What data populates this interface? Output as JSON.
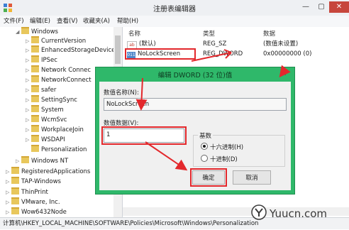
{
  "window": {
    "title": "注册表编辑器"
  },
  "menu": [
    "文件(F)",
    "编辑(E)",
    "查看(V)",
    "收藏夹(A)",
    "帮助(H)"
  ],
  "tree": {
    "items": [
      {
        "label": "Windows",
        "expanded": true
      },
      {
        "label": "CurrentVersion"
      },
      {
        "label": "EnhancedStorageDevice"
      },
      {
        "label": "IPSec"
      },
      {
        "label": "Network Connec"
      },
      {
        "label": "NetworkConnect"
      },
      {
        "label": "safer"
      },
      {
        "label": "SettingSync"
      },
      {
        "label": "System"
      },
      {
        "label": "WcmSvc"
      },
      {
        "label": "WorkplaceJoin"
      },
      {
        "label": "WSDAPI"
      },
      {
        "label": "Personalization"
      },
      {
        "label": "Windows NT"
      },
      {
        "label": "RegisteredApplications"
      },
      {
        "label": "TAP-Windows"
      },
      {
        "label": "ThinPrint"
      },
      {
        "label": "VMware, Inc."
      },
      {
        "label": "Wow6432Node"
      }
    ]
  },
  "list": {
    "headers": [
      "名称",
      "类型",
      "数据"
    ],
    "rows": [
      {
        "name": "(默认)",
        "type": "REG_SZ",
        "data": "(数值未设置)",
        "icon": "ab"
      },
      {
        "name": "NoLockScreen",
        "type": "REG_DWORD",
        "data": "0x00000000 (0)",
        "icon": "dword"
      }
    ]
  },
  "status": {
    "path": "计算机\\HKEY_LOCAL_MACHINE\\SOFTWARE\\Policies\\Microsoft\\Windows\\Personalization"
  },
  "dialog": {
    "title": "编辑 DWORD (32 位)值",
    "close": "×",
    "name_label": "数值名称(N):",
    "name_value": "NoLockScreen",
    "data_label": "数值数据(V):",
    "data_value": "1",
    "base_label": "基数",
    "base_options": [
      {
        "label": "十六进制(H)",
        "selected": true
      },
      {
        "label": "十进制(D)",
        "selected": false
      }
    ],
    "ok_label": "确定",
    "cancel_label": "取消"
  },
  "watermark": {
    "text": "Yuucn.com"
  },
  "colors": {
    "dialog_frame": "#2fb86a",
    "highlight": "#e3282c"
  }
}
